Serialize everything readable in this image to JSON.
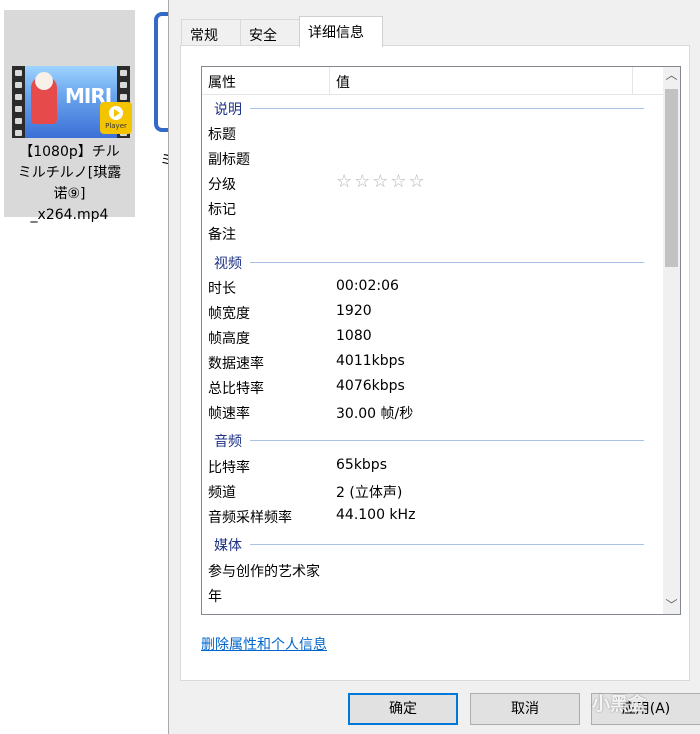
{
  "desktop": {
    "file_name": "【1080p】チル\nミルチルノ[琪露\n诺⑨]\n_x264.mp4",
    "thumb_text": "MIRI",
    "badge_label": "Player",
    "sliver_char": "ミ"
  },
  "dialog": {
    "tabs": [
      {
        "label": "常规"
      },
      {
        "label": "安全"
      },
      {
        "label": "详细信息"
      }
    ],
    "list": {
      "header": {
        "property": "属性",
        "value": "值"
      },
      "groups": [
        {
          "label": "说明"
        },
        {
          "label": "视频"
        },
        {
          "label": "音频"
        },
        {
          "label": "媒体"
        }
      ],
      "rows": [
        {
          "label": "标题",
          "value": ""
        },
        {
          "label": "副标题",
          "value": ""
        },
        {
          "label": "分级",
          "value": "☆☆☆☆☆"
        },
        {
          "label": "标记",
          "value": ""
        },
        {
          "label": "备注",
          "value": ""
        },
        {
          "label": "时长",
          "value": "00:02:06"
        },
        {
          "label": "帧宽度",
          "value": "1920"
        },
        {
          "label": "帧高度",
          "value": "1080"
        },
        {
          "label": "数据速率",
          "value": "4011kbps"
        },
        {
          "label": "总比特率",
          "value": "4076kbps"
        },
        {
          "label": "帧速率",
          "value": "30.00 帧/秒"
        },
        {
          "label": "比特率",
          "value": "65kbps"
        },
        {
          "label": "频道",
          "value": "2 (立体声)"
        },
        {
          "label": "音频采样频率",
          "value": "44.100 kHz"
        },
        {
          "label": "参与创作的艺术家",
          "value": ""
        },
        {
          "label": "年",
          "value": ""
        }
      ],
      "rating_stars": 0
    },
    "remove_link": "删除属性和个人信息",
    "buttons": {
      "ok": "确定",
      "cancel": "取消",
      "apply": "应用(A)"
    }
  },
  "watermark": "小黑盒"
}
